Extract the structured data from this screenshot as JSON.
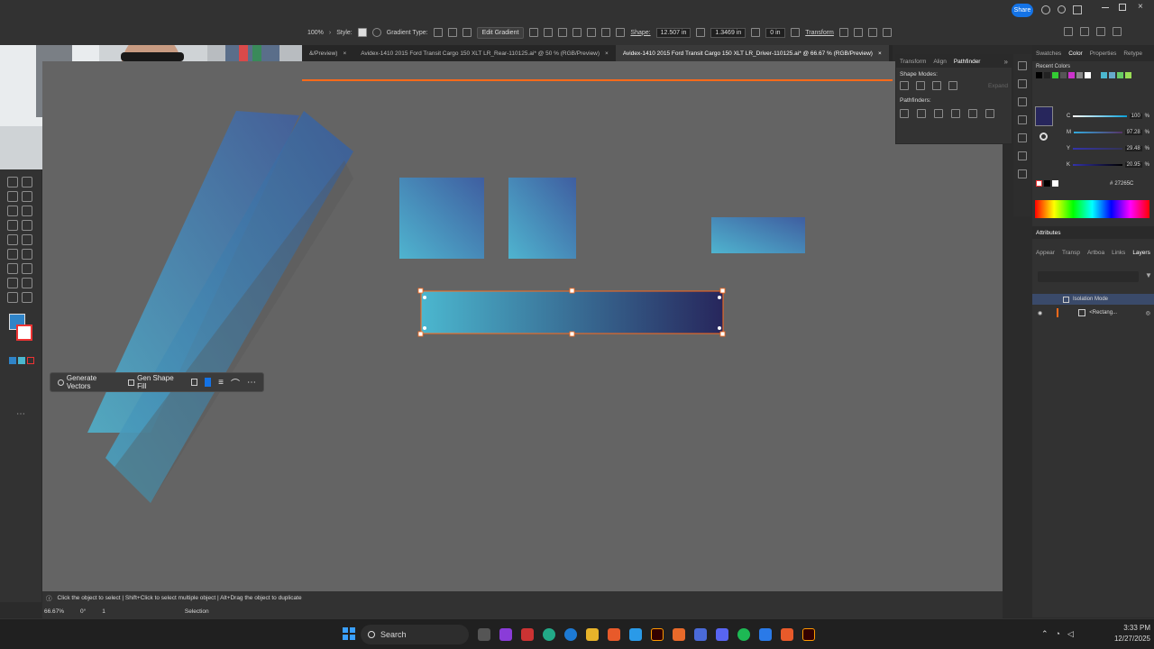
{
  "topbar": {
    "share_label": "Share"
  },
  "control_bar": {
    "zoom": "100%",
    "style_label": "Style:",
    "gradient_type_label": "Gradient Type:",
    "edit_gradient_label": "Edit Gradient",
    "shape_label": "Shape:",
    "width_value": "12.507 in",
    "height_value": "1.3469 in",
    "corner_value": "0 in",
    "transform_label": "Transform"
  },
  "tabs": [
    {
      "label": "&/Preview)"
    },
    {
      "label": "Avidex-1410 2015 Ford Transit Cargo 150 XLT LR_Rear-110125.ai* @ 50 % (RGB/Preview)"
    },
    {
      "label": "Avidex-1410 2015 Ford Transit Cargo 150 XLT LR_Driver-110125.ai* @ 66.67 % (RGB/Preview)"
    }
  ],
  "context_bar": {
    "generate_vectors": "Generate Vectors",
    "gen_shape_fill": "Gen Shape Fill"
  },
  "pathfinder_panel": {
    "tabs": [
      "Transform",
      "Align",
      "Pathfinder"
    ],
    "shape_modes_label": "Shape Modes:",
    "expand_label": "Expand",
    "pathfinders_label": "Pathfinders:"
  },
  "color_panel": {
    "tabs": [
      "Swatches",
      "Color",
      "Properties",
      "Retype"
    ],
    "recent_colors_label": "Recent Colors",
    "sliders": [
      {
        "label": "C",
        "value": "100",
        "unit": "%"
      },
      {
        "label": "M",
        "value": "97.28",
        "unit": "%"
      },
      {
        "label": "Y",
        "value": "29.48",
        "unit": "%"
      },
      {
        "label": "K",
        "value": "20.95",
        "unit": "%"
      }
    ],
    "hex_value": "27265C",
    "attributes_label": "Attributes",
    "fill_color": "#27265c"
  },
  "layers_panel": {
    "tabs": [
      "Appear",
      "Transp",
      "Artboa",
      "Links",
      "Layers"
    ],
    "rows": [
      {
        "label": "Isolation Mode"
      },
      {
        "label": "<Rectang..."
      }
    ]
  },
  "status_bar": {
    "hint": "Click the object to select  |  Shift+Click to select multiple object  |  Alt+Drag the object to duplicate",
    "zoom": "66.67%",
    "rotation": "0°",
    "artboard_num": "1",
    "mode": "Selection"
  },
  "taskbar": {
    "search_label": "Search",
    "time": "3:33 PM",
    "date": "12/27/2025"
  },
  "colors": {
    "accent": "#1473e6",
    "artboard_edge": "#ff6a1a",
    "gradient_light": "#4bb7cf",
    "gradient_dark": "#27265c"
  }
}
